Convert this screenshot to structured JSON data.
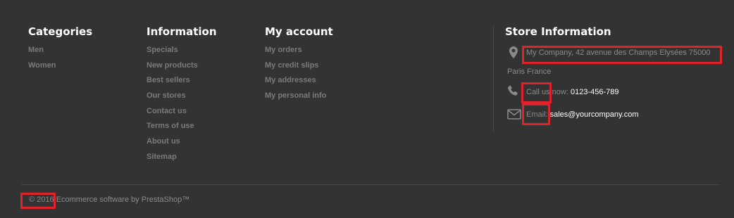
{
  "categories": {
    "title": "Categories",
    "items": [
      "Men",
      "Women"
    ]
  },
  "information": {
    "title": "Information",
    "items": [
      "Specials",
      "New products",
      "Best sellers",
      "Our stores",
      "Contact us",
      "Terms of use",
      "About us",
      "Sitemap"
    ]
  },
  "account": {
    "title": "My account",
    "items": [
      "My orders",
      "My credit slips",
      "My addresses",
      "My personal info"
    ]
  },
  "store": {
    "title": "Store Information",
    "address_line1": "My Company, 42 avenue des Champs Elysées 75000",
    "address_line2": "Paris France",
    "phone_label": "Call us now:",
    "phone_value": "0123-456-789",
    "email_label": "Email:",
    "email_value": "sales@yourcompany.com",
    "icons": [
      "map-marker-icon",
      "phone-icon",
      "envelope-icon"
    ]
  },
  "copyright": "© 2016 Ecommerce software by PrestaShop™",
  "colors": {
    "background": "#333333",
    "heading": "#ffffff",
    "link": "#7a7a7a",
    "highlight_box": "#e0232b"
  }
}
